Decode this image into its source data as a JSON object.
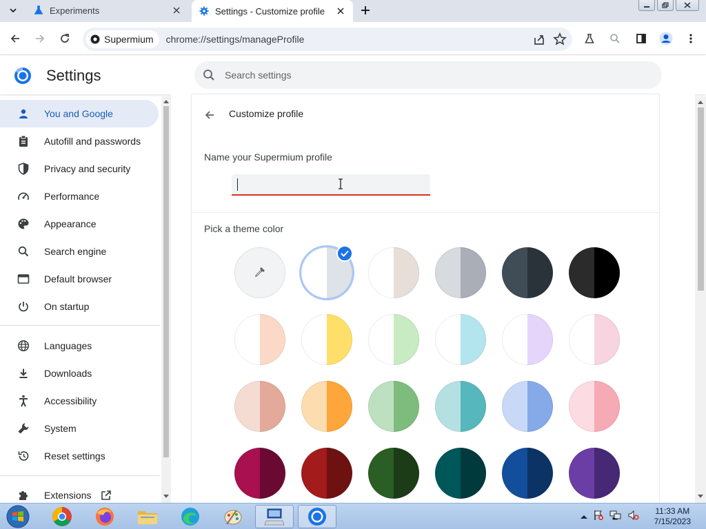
{
  "tabs": [
    {
      "title": "Experiments",
      "active": false
    },
    {
      "title": "Settings - Customize profile",
      "active": true
    }
  ],
  "toolbar": {
    "site_chip": "Supermium",
    "url": "chrome://settings/manageProfile"
  },
  "header": {
    "title": "Settings",
    "search_placeholder": "Search settings"
  },
  "sidebar": {
    "items": [
      {
        "label": "You and Google",
        "icon": "person-icon",
        "selected": true
      },
      {
        "label": "Autofill and passwords",
        "icon": "clipboard-icon"
      },
      {
        "label": "Privacy and security",
        "icon": "shield-icon"
      },
      {
        "label": "Performance",
        "icon": "gauge-icon"
      },
      {
        "label": "Appearance",
        "icon": "palette-icon"
      },
      {
        "label": "Search engine",
        "icon": "search-icon"
      },
      {
        "label": "Default browser",
        "icon": "browser-window-icon"
      },
      {
        "label": "On startup",
        "icon": "power-icon"
      },
      {
        "label": "Languages",
        "icon": "globe-icon"
      },
      {
        "label": "Downloads",
        "icon": "download-icon"
      },
      {
        "label": "Accessibility",
        "icon": "accessibility-icon"
      },
      {
        "label": "System",
        "icon": "wrench-icon"
      },
      {
        "label": "Reset settings",
        "icon": "reset-icon"
      },
      {
        "label": "Extensions",
        "icon": "puzzle-icon"
      }
    ]
  },
  "main": {
    "title": "Customize profile",
    "name_label": "Name your Supermium profile",
    "name_value": "",
    "theme_label": "Pick a theme color",
    "swatches": [
      {
        "left": "#f1f3f4",
        "right": "#f1f3f4",
        "type": "picker"
      },
      {
        "left": "#ffffff",
        "right": "#dee3e8",
        "selected": true
      },
      {
        "left": "#ffffff",
        "right": "#e7ded8"
      },
      {
        "left": "#d7dadf",
        "right": "#a9aeb7"
      },
      {
        "left": "#404c56",
        "right": "#2a333a"
      },
      {
        "left": "#2b2b2b",
        "right": "#000000"
      },
      {
        "left": "#ffffff",
        "right": "#fcd9c6"
      },
      {
        "left": "#ffffff",
        "right": "#fedf69"
      },
      {
        "left": "#ffffff",
        "right": "#c9ebc3"
      },
      {
        "left": "#ffffff",
        "right": "#b3e5ef"
      },
      {
        "left": "#ffffff",
        "right": "#e6d5fb"
      },
      {
        "left": "#ffffff",
        "right": "#f7d4e0"
      },
      {
        "left": "#f5dcd3",
        "right": "#e3a99a"
      },
      {
        "left": "#fddcb0",
        "right": "#fea53b"
      },
      {
        "left": "#bde0c0",
        "right": "#7dbc7d"
      },
      {
        "left": "#b5e0e2",
        "right": "#56b8bd"
      },
      {
        "left": "#c8d9f7",
        "right": "#86a9e8"
      },
      {
        "left": "#fcdbe2",
        "right": "#f6aab5"
      },
      {
        "left": "#a8104f",
        "right": "#6a0a33"
      },
      {
        "left": "#a31b1b",
        "right": "#6e1111"
      },
      {
        "left": "#2a5e24",
        "right": "#1b3c17"
      },
      {
        "left": "#00575a",
        "right": "#003a3d"
      },
      {
        "left": "#134e9c",
        "right": "#0b3366"
      },
      {
        "left": "#6b3ea6",
        "right": "#472874"
      }
    ]
  },
  "taskbar": {
    "time": "11:33 AM",
    "date": "7/15/2023"
  },
  "colors": {
    "accent": "#1a73e8",
    "selected_nav_bg": "#e4ebf7",
    "error_underline": "#d93025"
  }
}
